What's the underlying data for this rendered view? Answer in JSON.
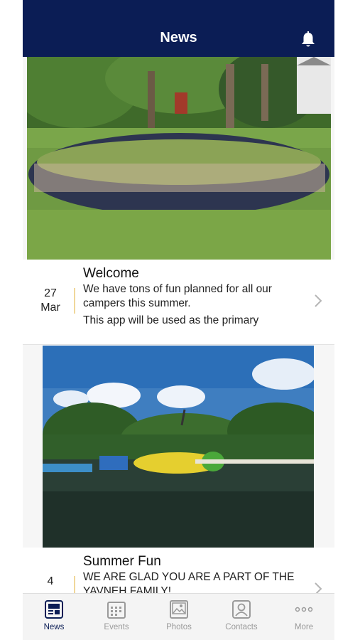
{
  "header": {
    "title": "News",
    "bell_icon": "bell-icon"
  },
  "posts": [
    {
      "image": "group-circle-photo",
      "day": "27",
      "month": "Mar",
      "title": "Welcome",
      "body_line1": "We have tons of fun planned for all our campers this summer.",
      "body_line2": "This app will be used as the primary"
    },
    {
      "image": "lake-blob-photo",
      "day": "4",
      "month": "",
      "title": "Summer Fun",
      "body_line1": "WE ARE GLAD YOU ARE A PART OF THE YAVNEH FAMILY!"
    }
  ],
  "tabs": [
    {
      "label": "News",
      "icon": "newspaper-icon",
      "active": true
    },
    {
      "label": "Events",
      "icon": "calendar-icon"
    },
    {
      "label": "Photos",
      "icon": "photo-icon"
    },
    {
      "label": "Contacts",
      "icon": "contact-icon"
    },
    {
      "label": "More",
      "icon": "ellipsis-icon"
    }
  ],
  "colors": {
    "navbar": "#0b1d55",
    "accent_divider": "#f0d79a",
    "tab_inactive": "#9a9a9a"
  }
}
